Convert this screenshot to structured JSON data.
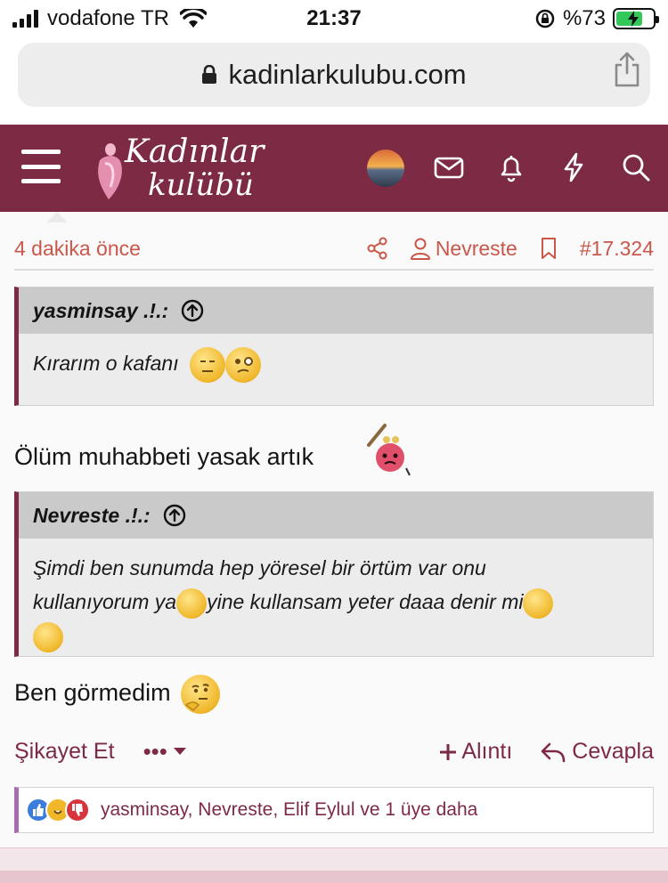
{
  "status_bar": {
    "carrier": "vodafone TR",
    "time": "21:37",
    "battery": "%73",
    "battery_fraction": 0.73
  },
  "browser": {
    "url": "kadinlarkulubu.com",
    "lock_icon": "lock-icon",
    "share_icon": "share-icon"
  },
  "site": {
    "logo_line1": "Kadınlar",
    "logo_line2": "kulübü",
    "brand_color": "#7d2a45",
    "header_icons": [
      "mail-icon",
      "bell-icon",
      "bolt-icon",
      "search-icon"
    ]
  },
  "post": {
    "time": "4 dakika önce",
    "author": "Nevreste",
    "post_number": "#17.324",
    "quote1": {
      "author": "yasminsay .!.:",
      "text": "Kırarım o kafanı"
    },
    "line1": "Ölüm muhabbeti yasak artık",
    "quote2": {
      "author": "Nevreste .!.:",
      "text_a": "Şimdi ben sunumda hep yöresel bir örtüm var onu",
      "text_b": "kullanıyorum ya",
      "text_c": "yine kullansam yeter daaa denir mi"
    },
    "line2": "Ben görmedim"
  },
  "actions": {
    "report": "Şikayet Et",
    "more": "•••",
    "quote": "Alıntı",
    "reply": "Cevapla"
  },
  "reactions": {
    "text": "yasminsay, Nevreste, Elif Eylul ve 1 üye daha"
  }
}
